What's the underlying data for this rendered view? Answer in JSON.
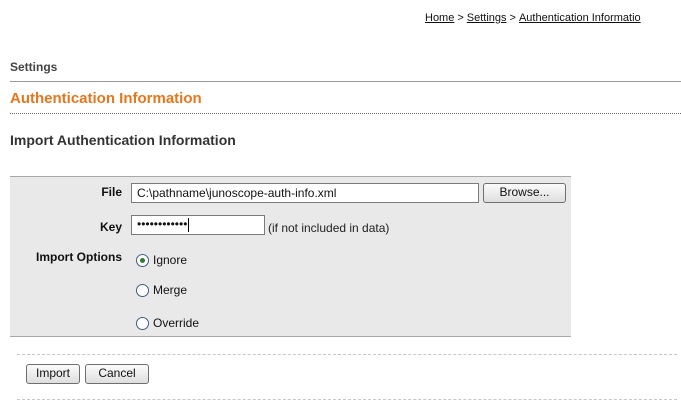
{
  "breadcrumb": {
    "items": [
      "Home",
      "Settings",
      "Authentication Informatio"
    ],
    "separator": ">"
  },
  "section": {
    "label": "Settings"
  },
  "page": {
    "title": "Authentication Information",
    "subtitle": "Import Authentication Information"
  },
  "form": {
    "file_label": "File",
    "file_value": "C:\\pathname\\junoscope-auth-info.xml",
    "browse_label": "Browse...",
    "key_label": "Key",
    "key_value": "••••••••••••",
    "key_hint": "(if not included in data)",
    "import_options_label": "Import Options",
    "options": [
      {
        "label": "Ignore",
        "selected": true
      },
      {
        "label": "Merge",
        "selected": false
      },
      {
        "label": "Override",
        "selected": false
      }
    ]
  },
  "actions": {
    "import_label": "Import",
    "cancel_label": "Cancel"
  },
  "colors": {
    "accent": "#e8761b",
    "panel": "#e9e9e9",
    "radio_selected": "#2e7d32"
  }
}
